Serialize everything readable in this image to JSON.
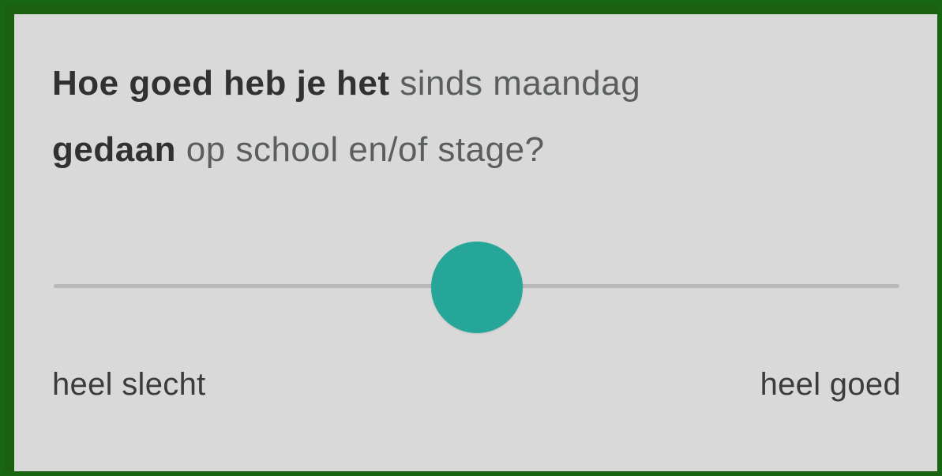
{
  "question": {
    "part1_bold": "Hoe goed heb je het",
    "part2": " sinds maandag ",
    "part3_bold": "gedaan",
    "part4": " op school en/of stage?"
  },
  "slider": {
    "value": 0.5,
    "min_label": "heel slecht",
    "max_label": "heel goed",
    "track_color": "#b9b9b9",
    "thumb_color": "#26a699"
  },
  "colors": {
    "frame": "#186612",
    "background": "#d9d9d9"
  }
}
